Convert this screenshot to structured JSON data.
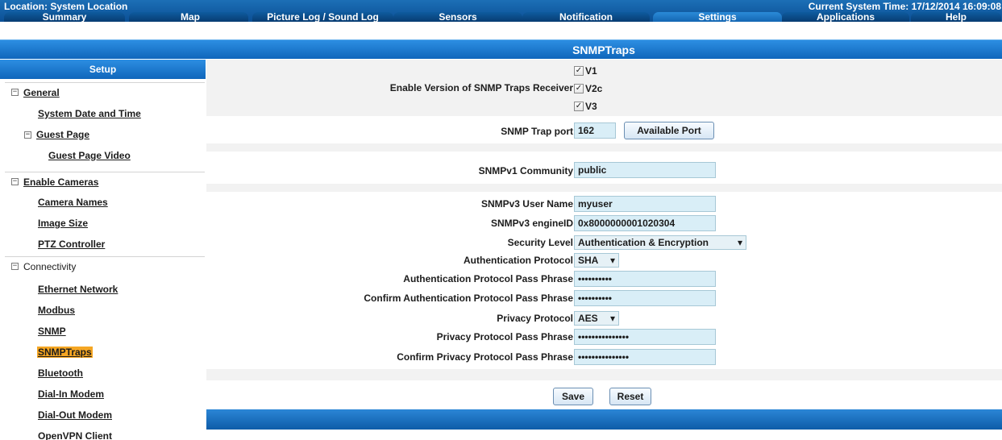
{
  "header": {
    "location": "Location: System Location",
    "system_time": "Current System Time: 17/12/2014 16:09:08"
  },
  "tabs": [
    {
      "label": "Summary"
    },
    {
      "label": "Map"
    },
    {
      "label": "Picture Log / Sound Log"
    },
    {
      "label": "Sensors"
    },
    {
      "label": "Notification"
    },
    {
      "label": "Settings",
      "active": true
    },
    {
      "label": "Applications"
    },
    {
      "label": "Help"
    }
  ],
  "page_title": "SNMPTraps",
  "sidebar": {
    "header": "Setup",
    "groups": {
      "general": "General",
      "enable_cameras": "Enable Cameras",
      "connectivity": "Connectivity"
    },
    "items": {
      "system_date_time": "System Date and Time",
      "guest_page": "Guest Page",
      "guest_page_video": "Guest Page Video",
      "camera_names": "Camera Names",
      "image_size": "Image Size",
      "ptz_controller": "PTZ Controller",
      "ethernet_network": "Ethernet Network",
      "modbus": "Modbus",
      "snmp": "SNMP",
      "snmptraps": "SNMPTraps",
      "bluetooth": "Bluetooth",
      "dial_in_modem": "Dial-In Modem",
      "dial_out_modem": "Dial-Out Modem",
      "openvpn_client": "OpenVPN Client"
    },
    "selected": "SNMPTraps"
  },
  "form": {
    "enable_versions_label": "Enable Version of SNMP Traps Receiver",
    "versions": [
      {
        "label": "V1",
        "checked": true
      },
      {
        "label": "V2c",
        "checked": true
      },
      {
        "label": "V3",
        "checked": true
      }
    ],
    "trap_port_label": "SNMP Trap port",
    "trap_port_value": "162",
    "available_port_button": "Available Port",
    "v1_community_label": "SNMPv1 Community",
    "v1_community_value": "public",
    "v3_user_label": "SNMPv3 User Name",
    "v3_user_value": "myuser",
    "v3_engine_label": "SNMPv3 engineID",
    "v3_engine_value": "0x8000000001020304",
    "security_level_label": "Security Level",
    "security_level_value": "Authentication & Encryption",
    "auth_protocol_label": "Authentication Protocol",
    "auth_protocol_value": "SHA",
    "auth_pass_label": "Authentication Protocol Pass Phrase",
    "auth_pass_value": "••••••••••",
    "confirm_auth_pass_label": "Confirm Authentication Protocol Pass Phrase",
    "confirm_auth_pass_value": "••••••••••",
    "privacy_protocol_label": "Privacy Protocol",
    "privacy_protocol_value": "AES",
    "privacy_pass_label": "Privacy Protocol Pass Phrase",
    "privacy_pass_value": "•••••••••••••••",
    "confirm_privacy_pass_label": "Confirm Privacy Protocol Pass Phrase",
    "confirm_privacy_pass_value": "•••••••••••••••",
    "save_button": "Save",
    "reset_button": "Reset"
  },
  "colors": {
    "primary_blue": "#0f66bb",
    "selected_highlight": "#f5a623",
    "field_bg": "#d9eef7"
  },
  "icons": {
    "collapse": "minus-box-icon",
    "dropdown": "triangle-down-icon",
    "checkmark": "checkmark-icon"
  }
}
